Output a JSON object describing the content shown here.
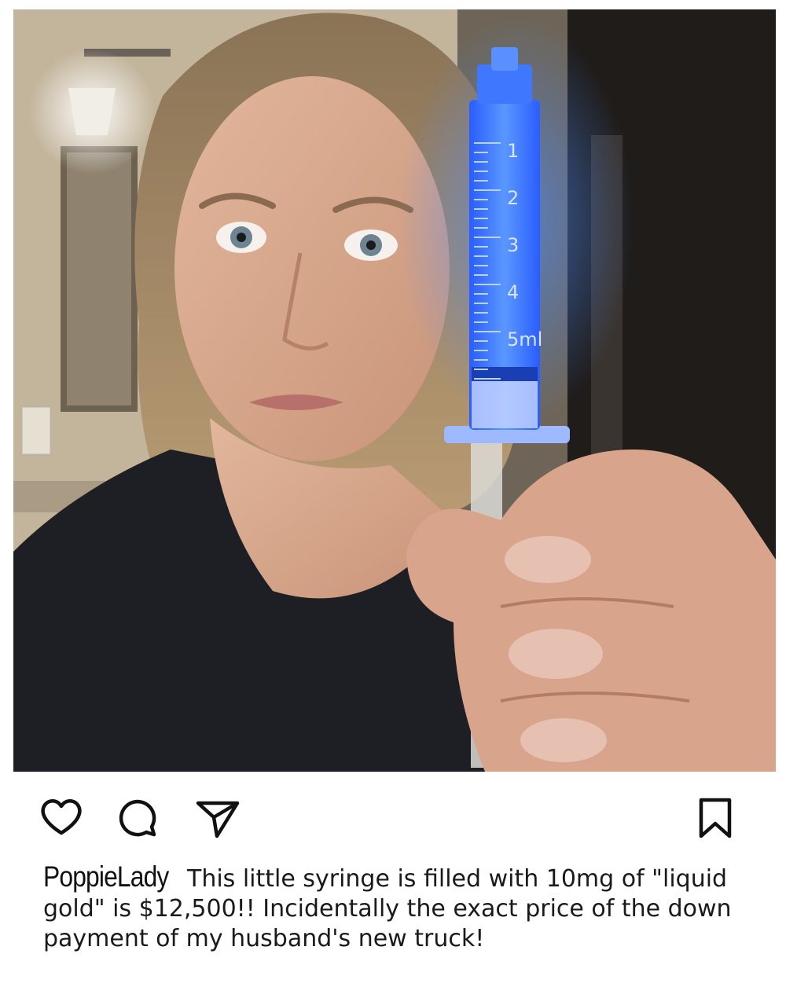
{
  "post": {
    "image_alt": "Woman holding a syringe filled with glowing blue liquid",
    "syringe_scale": [
      "1",
      "2",
      "3",
      "4",
      "5ml"
    ],
    "actions": {
      "like_icon": "heart-icon",
      "comment_icon": "comment-bubble-icon",
      "share_icon": "paper-plane-icon",
      "save_icon": "bookmark-icon"
    },
    "caption": {
      "username": "PoppieLady",
      "text": "This little syringe is filled with 10mg of \"liquid gold\" is $12,500!! Incidentally the exact price of the down payment of my husband's new truck!"
    }
  },
  "colors": {
    "syringe_glow": "#3d7bff",
    "icon_stroke": "#111111",
    "text": "#1a1a1a"
  }
}
